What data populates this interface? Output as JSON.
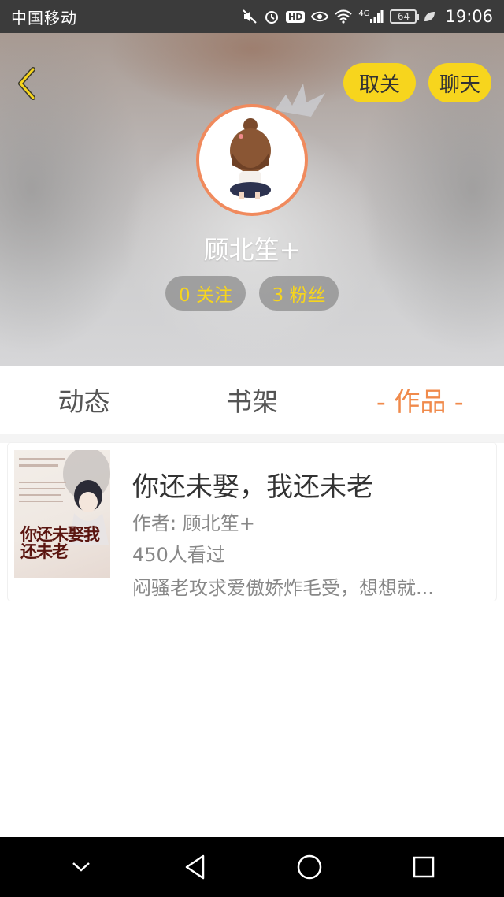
{
  "status_bar": {
    "carrier": "中国移动",
    "network": "4G",
    "hd": "HD",
    "battery": "64",
    "time": "19:06",
    "icons": [
      "mute-icon",
      "alarm-icon",
      "hd-icon",
      "eye-icon",
      "wifi-icon",
      "signal-icon",
      "battery-icon",
      "leaf-icon"
    ]
  },
  "header": {
    "back_icon": "chevron-left-icon",
    "unfollow_label": "取关",
    "chat_label": "聊天",
    "username": "顾北笙+",
    "following": "0 关注",
    "followers": "3 粉丝",
    "accent_color": "#f7d51d",
    "avatar_border_color": "#f08a5d"
  },
  "tabs": [
    {
      "label": "动态",
      "active": false
    },
    {
      "label": "书架",
      "active": false
    },
    {
      "label": "- 作品 -",
      "active": true
    }
  ],
  "works": [
    {
      "cover_title": "你还未娶我还未老",
      "title": "你还未娶，我还未老",
      "author": "作者: 顾北笙+",
      "views": "450人看过",
      "description": "闷骚老攻求爱傲娇炸毛受，想想就..."
    }
  ],
  "nav_bar": {
    "icons": [
      "hide-keyboard-icon",
      "back-triangle-icon",
      "home-circle-icon",
      "recents-square-icon"
    ]
  }
}
